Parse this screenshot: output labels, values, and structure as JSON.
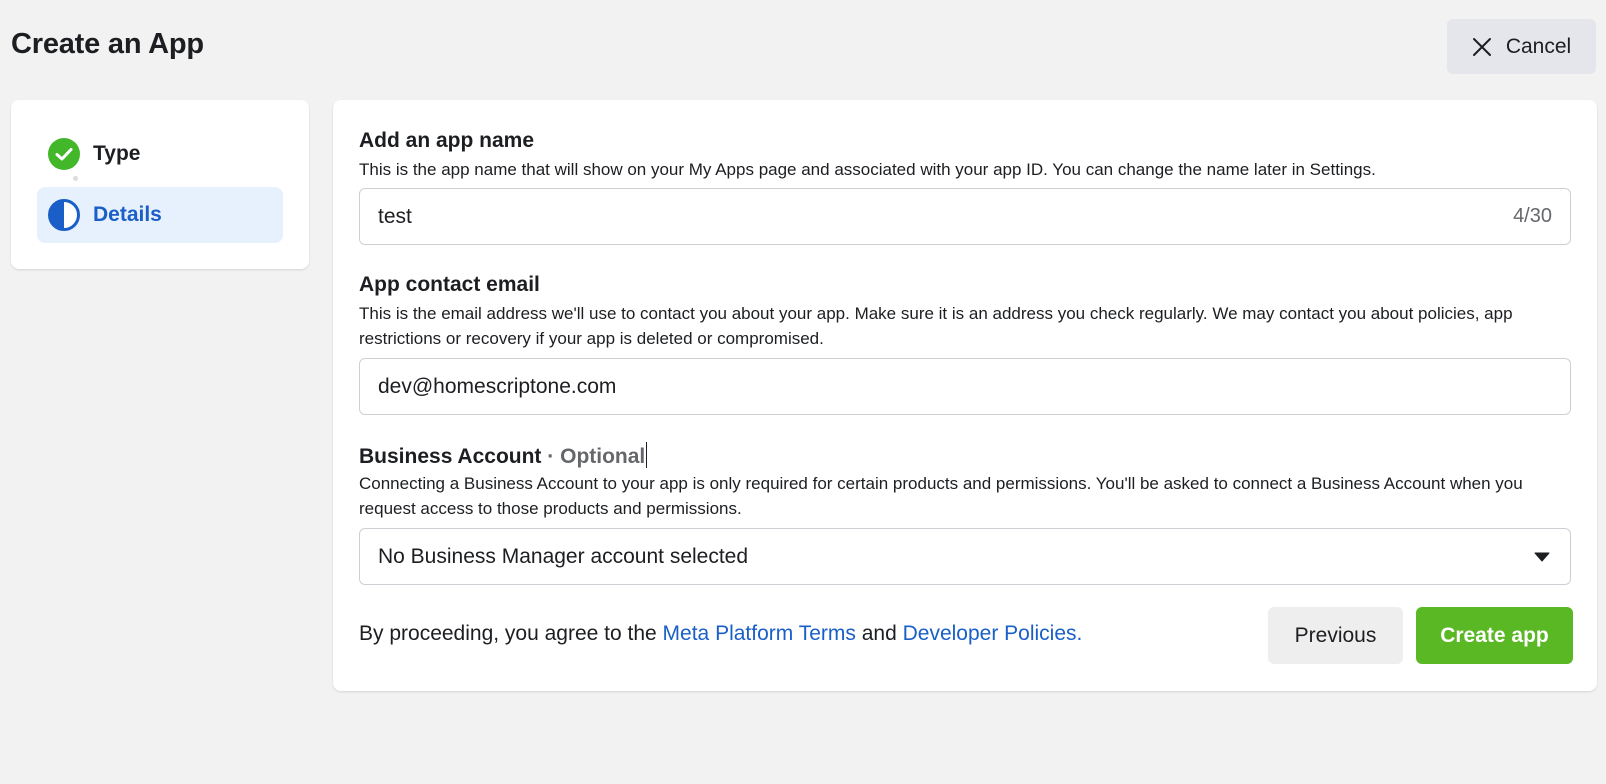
{
  "header": {
    "title": "Create an App",
    "cancel_label": "Cancel",
    "cancel_icon": "close-icon"
  },
  "steps": [
    {
      "label": "Type",
      "status": "completed",
      "icon": "check-circle-icon",
      "color": "#42b72a"
    },
    {
      "label": "Details",
      "status": "current",
      "icon": "half-circle-icon",
      "color": "#1a5fc8"
    }
  ],
  "form": {
    "app_name": {
      "title": "Add an app name",
      "description": "This is the app name that will show on your My Apps page and associated with your app ID. You can change the name later in Settings.",
      "value": "test",
      "counter": "4/30"
    },
    "contact_email": {
      "title": "App contact email",
      "description": "This is the email address we'll use to contact you about your app. Make sure it is an address you check regularly. We may contact you about policies, app restrictions or recovery if your app is deleted or compromised.",
      "value": "dev@homescriptone.com"
    },
    "business_account": {
      "title": "Business Account",
      "optional_label": "· Optional",
      "description": "Connecting a Business Account to your app is only required for certain products and permissions. You'll be asked to connect a Business Account when you request access to those products and permissions.",
      "selected": "No Business Manager account selected"
    }
  },
  "footer": {
    "terms_prefix": "By proceeding, you agree to the",
    "terms_link": "Meta Platform Terms",
    "terms_and": "and",
    "policies_link": "Developer Policies.",
    "previous_label": "Previous",
    "create_label": "Create app"
  },
  "colors": {
    "accent": "#1a5fc8",
    "primary_button": "#5ab825",
    "background": "#f2f2f2"
  }
}
